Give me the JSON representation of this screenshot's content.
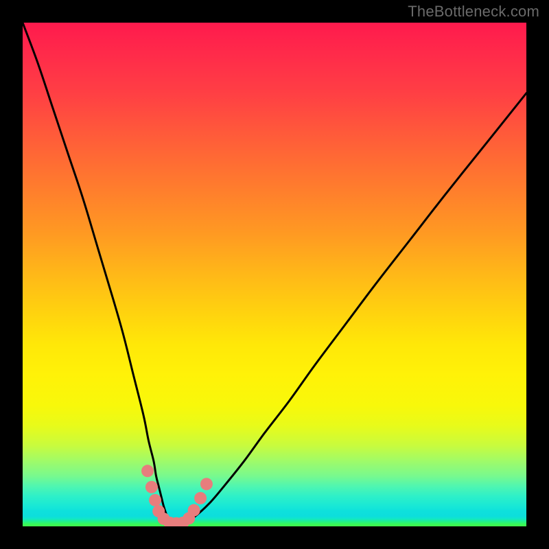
{
  "watermark": "TheBottleneck.com",
  "colors": {
    "frame": "#000000",
    "curve_stroke": "#000000",
    "marker_fill": "#e77d7d",
    "marker_stroke": "#c85a5a"
  },
  "chart_data": {
    "type": "line",
    "title": "",
    "xlabel": "",
    "ylabel": "",
    "xlim": [
      0,
      100
    ],
    "ylim": [
      0,
      100
    ],
    "grid": false,
    "series": [
      {
        "name": "bottleneck-curve",
        "x": [
          0,
          3,
          6,
          9,
          12,
          15,
          18,
          20,
          22,
          24,
          25,
          26,
          26.5,
          27,
          27.5,
          28,
          28.5,
          29,
          30,
          31,
          32,
          34,
          37,
          40,
          44,
          48,
          53,
          58,
          64,
          70,
          77,
          84,
          92,
          100
        ],
        "y": [
          100,
          92,
          83,
          74,
          65,
          55,
          45,
          38,
          30,
          22,
          17,
          13,
          10,
          8,
          6,
          4,
          2.5,
          1.5,
          0.6,
          0.2,
          0.6,
          1.8,
          4.5,
          8,
          13,
          18.5,
          25,
          32,
          40,
          48,
          57,
          66,
          76,
          86
        ]
      }
    ],
    "markers": [
      {
        "x": 24.8,
        "y": 11.0
      },
      {
        "x": 25.6,
        "y": 7.8
      },
      {
        "x": 26.3,
        "y": 5.2
      },
      {
        "x": 27.0,
        "y": 3.0
      },
      {
        "x": 28.0,
        "y": 1.5
      },
      {
        "x": 29.2,
        "y": 0.7
      },
      {
        "x": 30.5,
        "y": 0.6
      },
      {
        "x": 31.8,
        "y": 0.7
      },
      {
        "x": 33.0,
        "y": 1.6
      },
      {
        "x": 34.0,
        "y": 3.2
      },
      {
        "x": 35.3,
        "y": 5.6
      },
      {
        "x": 36.5,
        "y": 8.4
      }
    ]
  }
}
